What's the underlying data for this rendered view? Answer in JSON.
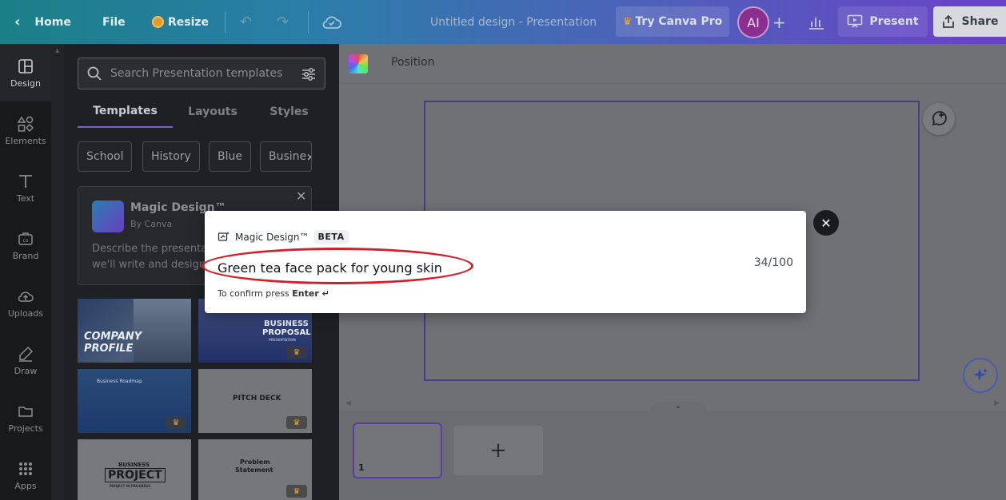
{
  "header": {
    "home_label": "Home",
    "file_label": "File",
    "resize_label": "Resize",
    "title": "Untitled design - Presentation",
    "pro_label": "Try Canva Pro",
    "avatar_initials": "AI",
    "present_label": "Present",
    "share_label": "Share"
  },
  "rail": {
    "items": [
      {
        "label": "Design",
        "icon": "layout-icon"
      },
      {
        "label": "Elements",
        "icon": "shapes-icon"
      },
      {
        "label": "Text",
        "icon": "text-icon"
      },
      {
        "label": "Brand",
        "icon": "brand-icon"
      },
      {
        "label": "Uploads",
        "icon": "cloud-upload-icon"
      },
      {
        "label": "Draw",
        "icon": "pen-icon"
      },
      {
        "label": "Projects",
        "icon": "folder-icon"
      },
      {
        "label": "Apps",
        "icon": "grid-icon"
      }
    ]
  },
  "panel": {
    "search_placeholder": "Search Presentation templates",
    "tabs": [
      "Templates",
      "Layouts",
      "Styles"
    ],
    "chips": [
      "School",
      "History",
      "Blue",
      "Busine"
    ],
    "magic_card": {
      "title": "Magic Design™",
      "by": "By Canva",
      "desc_line1": "Describe the presentat",
      "desc_line2": "we'll write and design a"
    },
    "templates": [
      {
        "line1": "COMPANY",
        "line2": "PROFILE"
      },
      {
        "line1": "BUSINESS",
        "line2": "PROPOSAL",
        "line3": "PRESENTATION"
      },
      {
        "line1": "Business Roadmap"
      },
      {
        "line1": "PITCH DECK"
      },
      {
        "line1": "BUSINESS",
        "line2": "PROJECT",
        "line3": "PROJECT IN PROGRESS"
      },
      {
        "line1": "Problem",
        "line2": "Statement"
      }
    ]
  },
  "toolbar": {
    "position_label": "Position"
  },
  "pages": {
    "current": "1",
    "add_symbol": "+"
  },
  "modal": {
    "title": "Magic Design™",
    "badge": "BETA",
    "input_value": "Green tea face pack for young skin",
    "counter": "34/100",
    "confirm_prefix": "To confirm press ",
    "confirm_key": "Enter ↵"
  },
  "colors": {
    "accent": "#7c5fd4",
    "annotation": "#d61e2a",
    "pro": "#f2a72a"
  }
}
